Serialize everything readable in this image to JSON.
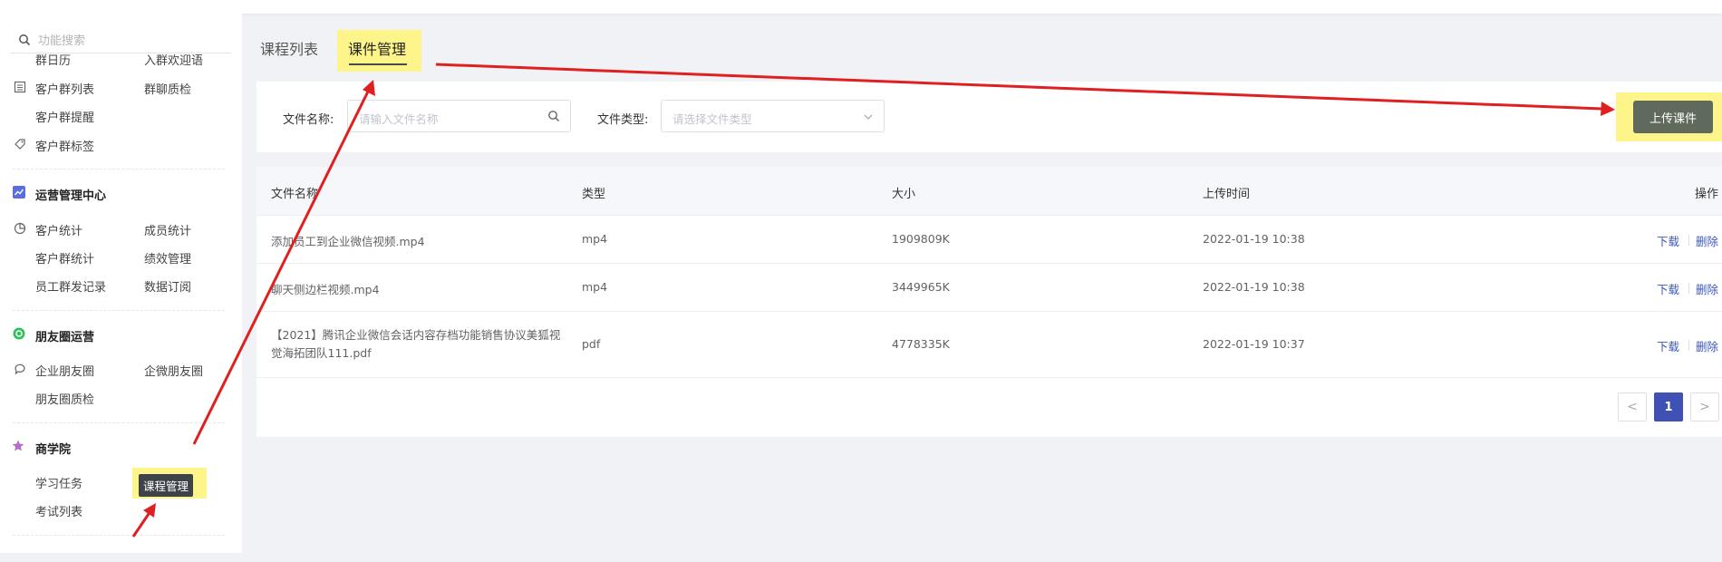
{
  "sidebar": {
    "search_placeholder": "功能搜索",
    "top_items": [
      "群日历",
      "入群欢迎语",
      "客户群列表",
      "群聊质检",
      "客户群提醒",
      "客户群标签"
    ],
    "section_ops": {
      "title": "运营管理中心",
      "items": [
        "客户统计",
        "成员统计",
        "客户群统计",
        "绩效管理",
        "员工群发记录",
        "数据订阅"
      ]
    },
    "section_moments": {
      "title": "朋友圈运营",
      "items": [
        "企业朋友圈",
        "企微朋友圈",
        "朋友圈质检"
      ]
    },
    "section_academy": {
      "title": "商学院",
      "items": [
        "学习任务",
        "课程管理",
        "考试列表"
      ]
    }
  },
  "tabs": [
    "课程列表",
    "课件管理"
  ],
  "filters": {
    "name_label": "文件名称:",
    "name_placeholder": "请输入文件名称",
    "type_label": "文件类型:",
    "type_placeholder": "请选择文件类型",
    "upload_label": "上传课件"
  },
  "table": {
    "headers": [
      "文件名称",
      "类型",
      "大小",
      "上传时间",
      "操作"
    ],
    "rows": [
      {
        "name": "添加员工到企业微信视频.mp4",
        "type": "mp4",
        "size": "1909809K",
        "time": "2022-01-19 10:38"
      },
      {
        "name": "聊天侧边栏视频.mp4",
        "type": "mp4",
        "size": "3449965K",
        "time": "2022-01-19 10:38"
      },
      {
        "name": "【2021】腾讯企业微信会话内容存档功能销售协议美狐视觉海拓团队111.pdf",
        "type": "pdf",
        "size": "4778335K",
        "time": "2022-01-19 10:37"
      }
    ],
    "op_download": "下载",
    "op_delete": "删除"
  },
  "pagination": {
    "current": "1",
    "prev": "<",
    "next": ">"
  },
  "colors": {
    "highlight": "#fdf58a",
    "annotation_arrow": "#e02020",
    "link": "#3c57b9",
    "page_active": "#3f51b5",
    "upload_button": "#5f6a5c"
  },
  "icons": [
    "search-icon",
    "list-icon",
    "tag-icon",
    "chart-icon",
    "pie-icon",
    "moments-icon",
    "chat-icon",
    "academy-icon",
    "chevron-down-icon"
  ]
}
